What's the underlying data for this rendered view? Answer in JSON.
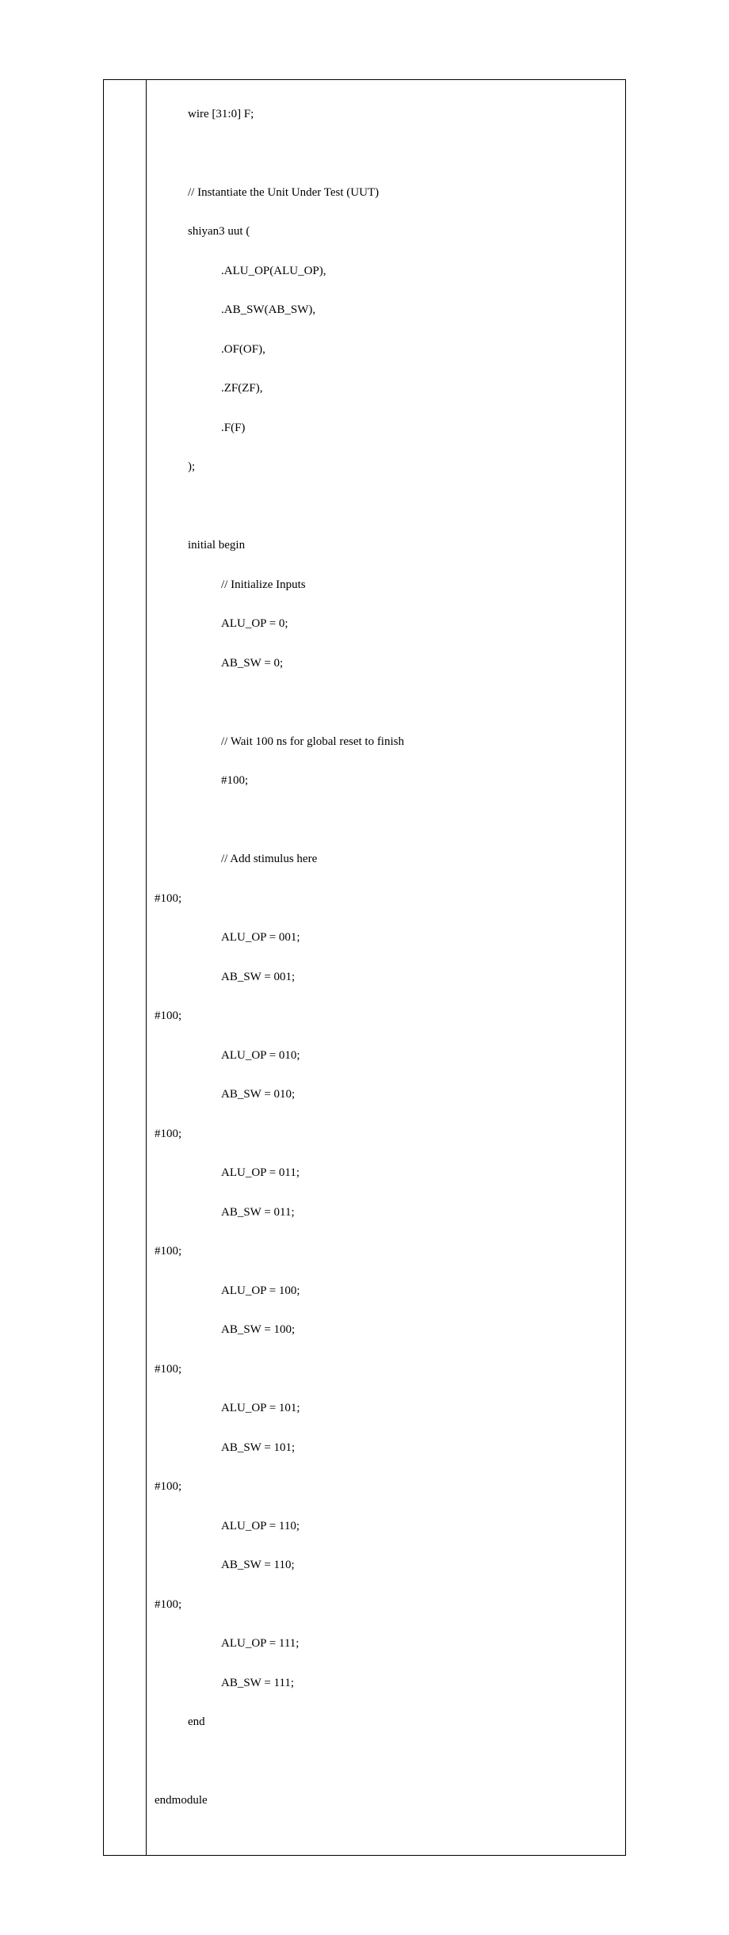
{
  "code": {
    "l1": "wire [31:0] F;",
    "l2": "// Instantiate the Unit Under Test (UUT)",
    "l3": "shiyan3 uut (",
    "l4": ".ALU_OP(ALU_OP),",
    "l5": ".AB_SW(AB_SW),",
    "l6": ".OF(OF),",
    "l7": ".ZF(ZF),",
    "l8": ".F(F)",
    "l9": ");",
    "l10": "initial begin",
    "l11": "// Initialize Inputs",
    "l12": "ALU_OP = 0;",
    "l13": "AB_SW = 0;",
    "l14": "// Wait 100 ns for global reset to finish",
    "l15": "#100;",
    "l16": "// Add stimulus here",
    "l17": "#100;",
    "l18": "ALU_OP = 001;",
    "l19": "AB_SW = 001;",
    "l20": "#100;",
    "l21": "ALU_OP = 010;",
    "l22": "AB_SW = 010;",
    "l23": "#100;",
    "l24": "ALU_OP = 011;",
    "l25": "AB_SW = 011;",
    "l26": "#100;",
    "l27": "ALU_OP = 100;",
    "l28": "AB_SW = 100;",
    "l29": "#100;",
    "l30": "ALU_OP = 101;",
    "l31": "AB_SW = 101;",
    "l32": "#100;",
    "l33": "ALU_OP = 110;",
    "l34": "AB_SW = 110;",
    "l35": "#100;",
    "l36": "ALU_OP = 111;",
    "l37": "AB_SW = 111;",
    "l38": "end",
    "l39": "endmodule"
  }
}
